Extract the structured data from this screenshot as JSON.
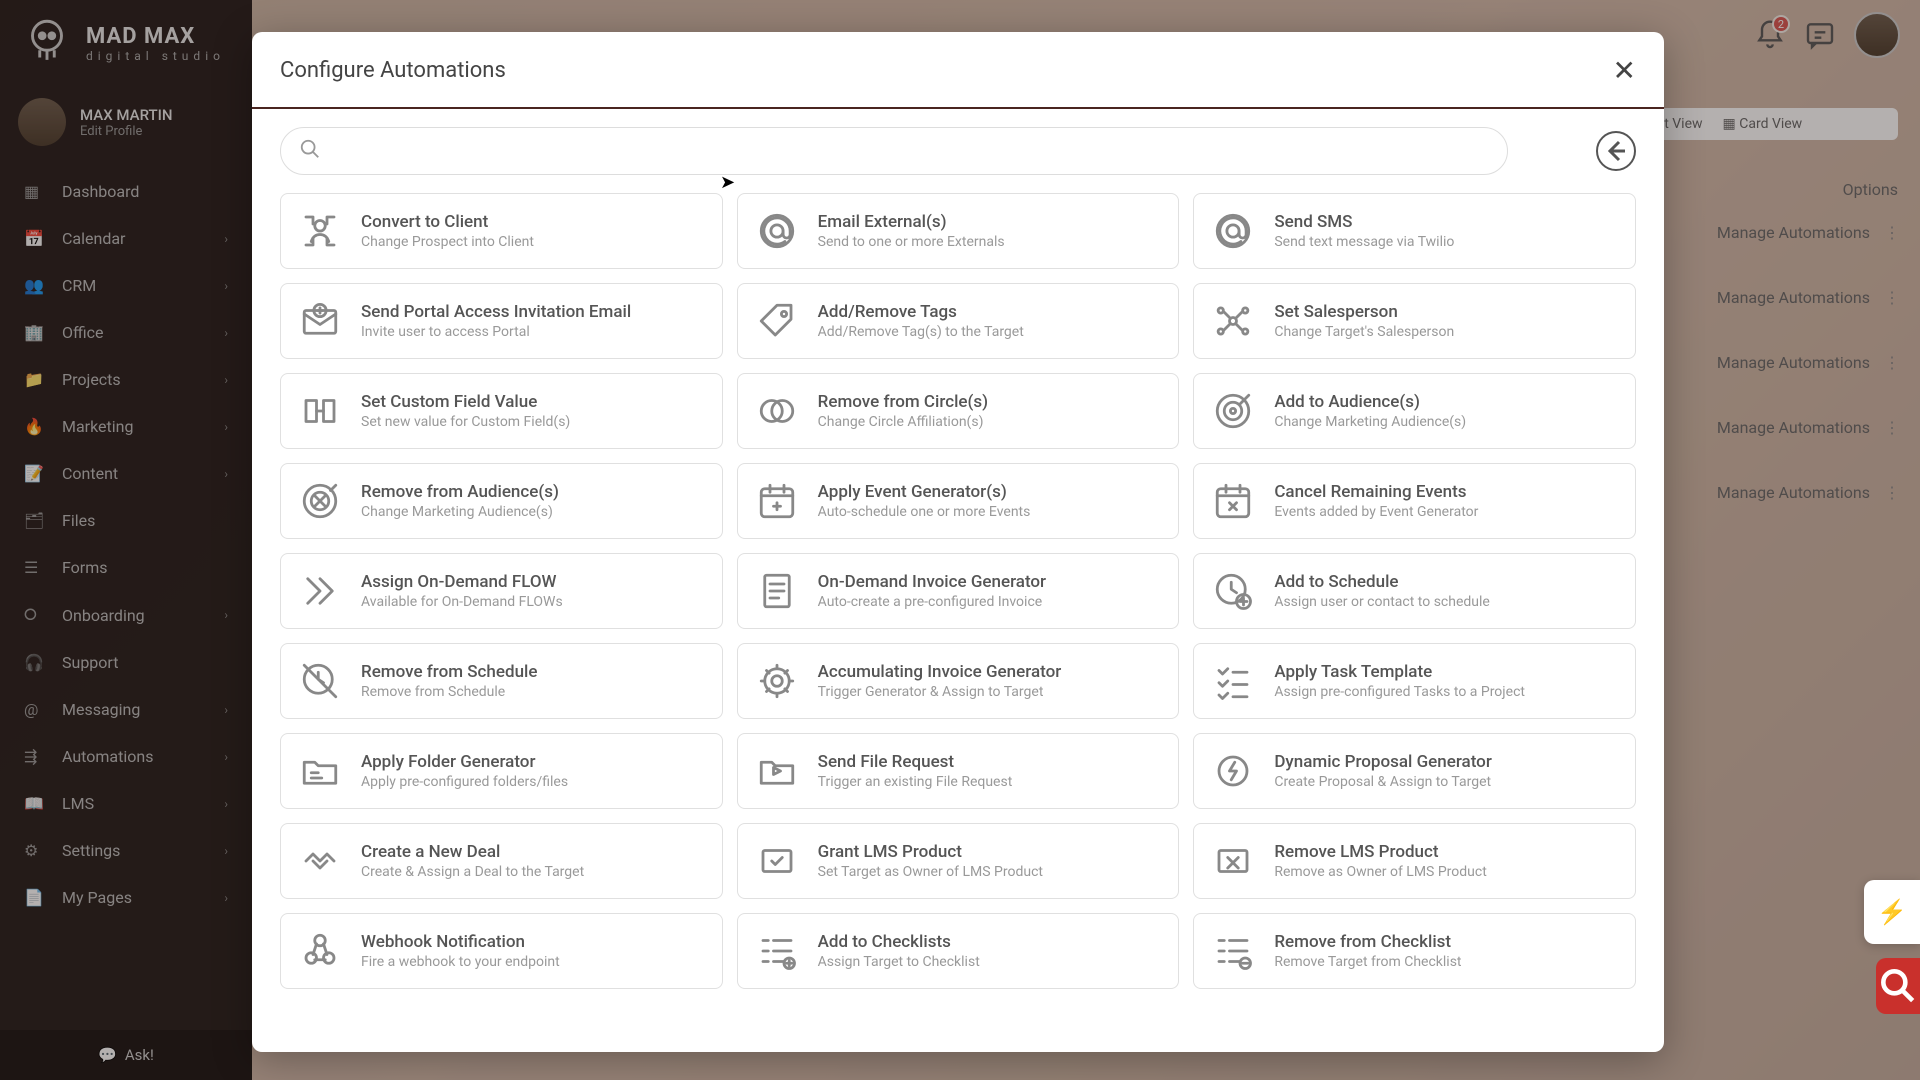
{
  "brand": {
    "line1": "MAD MAX",
    "line2": "digital studio"
  },
  "profile": {
    "name": "MAX MARTIN",
    "edit": "Edit Profile"
  },
  "sidebar": [
    {
      "label": "Dashboard",
      "expandable": false
    },
    {
      "label": "Calendar",
      "expandable": true
    },
    {
      "label": "CRM",
      "expandable": true
    },
    {
      "label": "Office",
      "expandable": true
    },
    {
      "label": "Projects",
      "expandable": true
    },
    {
      "label": "Marketing",
      "expandable": true
    },
    {
      "label": "Content",
      "expandable": true
    },
    {
      "label": "Files",
      "expandable": false
    },
    {
      "label": "Forms",
      "expandable": false
    },
    {
      "label": "Onboarding",
      "expandable": true
    },
    {
      "label": "Support",
      "expandable": false
    },
    {
      "label": "Messaging",
      "expandable": true
    },
    {
      "label": "Automations",
      "expandable": true
    },
    {
      "label": "LMS",
      "expandable": true
    },
    {
      "label": "Settings",
      "expandable": true
    },
    {
      "label": "My Pages",
      "expandable": true
    }
  ],
  "ask": "Ask!",
  "notifications_badge": "2",
  "bgpage": {
    "list_view": "List View",
    "card_view": "Card View",
    "options": "Options",
    "manage": "Manage Automations"
  },
  "modal": {
    "title": "Configure Automations",
    "search_placeholder": "",
    "cards": [
      {
        "title": "Convert to Client",
        "desc": "Change Prospect into Client",
        "icon": "user-convert"
      },
      {
        "title": "Email External(s)",
        "desc": "Send to one or more Externals",
        "icon": "at"
      },
      {
        "title": "Send SMS",
        "desc": "Send text message via Twilio",
        "icon": "at"
      },
      {
        "title": "Send Portal Access Invitation Email",
        "desc": "Invite user to access Portal",
        "icon": "mail-plus"
      },
      {
        "title": "Add/Remove Tags",
        "desc": "Add/Remove Tag(s) to the Target",
        "icon": "tag"
      },
      {
        "title": "Set Salesperson",
        "desc": "Change Target's Salesperson",
        "icon": "network"
      },
      {
        "title": "Set Custom Field Value",
        "desc": "Set new value for Custom Field(s)",
        "icon": "slider"
      },
      {
        "title": "Remove from Circle(s)",
        "desc": "Change Circle Affiliation(s)",
        "icon": "circles"
      },
      {
        "title": "Add to Audience(s)",
        "desc": "Change Marketing Audience(s)",
        "icon": "target"
      },
      {
        "title": "Remove from Audience(s)",
        "desc": "Change Marketing Audience(s)",
        "icon": "target-x"
      },
      {
        "title": "Apply Event Generator(s)",
        "desc": "Auto-schedule one or more Events",
        "icon": "calendar-plus"
      },
      {
        "title": "Cancel Remaining Events",
        "desc": "Events added by Event Generator",
        "icon": "calendar-x"
      },
      {
        "title": "Assign On-Demand FLOW",
        "desc": "Available for On-Demand FLOWs",
        "icon": "chevrons"
      },
      {
        "title": "On-Demand Invoice Generator",
        "desc": "Auto-create a pre-configured Invoice",
        "icon": "invoice"
      },
      {
        "title": "Add to Schedule",
        "desc": "Assign user or contact to schedule",
        "icon": "clock-plus"
      },
      {
        "title": "Remove from Schedule",
        "desc": "Remove from Schedule",
        "icon": "clock-x"
      },
      {
        "title": "Accumulating Invoice Generator",
        "desc": "Trigger Generator & Assign to Target",
        "icon": "gear-gen"
      },
      {
        "title": "Apply Task Template",
        "desc": "Assign pre-configured Tasks to a Project",
        "icon": "checklist"
      },
      {
        "title": "Apply Folder Generator",
        "desc": "Apply pre-configured folders/files",
        "icon": "folder-gen"
      },
      {
        "title": "Send File Request",
        "desc": "Trigger an existing File Request",
        "icon": "folder-send"
      },
      {
        "title": "Dynamic Proposal Generator",
        "desc": "Create Proposal & Assign to Target",
        "icon": "gear-bolt"
      },
      {
        "title": "Create a New Deal",
        "desc": "Create & Assign a Deal to the Target",
        "icon": "handshake"
      },
      {
        "title": "Grant LMS Product",
        "desc": "Set Target as Owner of LMS Product",
        "icon": "cart-check"
      },
      {
        "title": "Remove LMS Product",
        "desc": "Remove as Owner of LMS Product",
        "icon": "cart-x"
      },
      {
        "title": "Webhook Notification",
        "desc": "Fire a webhook to your endpoint",
        "icon": "webhook"
      },
      {
        "title": "Add to Checklists",
        "desc": "Assign Target to Checklist",
        "icon": "checklist-plus"
      },
      {
        "title": "Remove from Checklist",
        "desc": "Remove Target from Checklist",
        "icon": "checklist-minus"
      }
    ]
  }
}
